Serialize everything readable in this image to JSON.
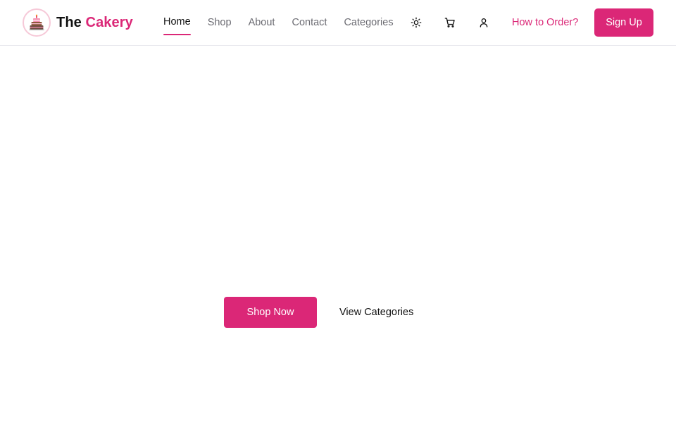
{
  "header": {
    "logo_icon": "layered-cake-icon",
    "brand_first": "The",
    "brand_second": "Cakery",
    "nav": [
      {
        "label": "Home",
        "active": true
      },
      {
        "label": "Shop",
        "active": false
      },
      {
        "label": "About",
        "active": false
      },
      {
        "label": "Contact",
        "active": false
      },
      {
        "label": "Categories",
        "active": false
      }
    ],
    "icons": [
      "sun-icon",
      "cart-icon",
      "user-icon"
    ],
    "how_to_order": "How to Order?",
    "sign_up": "Sign Up"
  },
  "hero": {
    "shop_now": "Shop Now",
    "view_categories": "View Categories"
  },
  "colors": {
    "accent": "#db2777",
    "text": "#111111",
    "muted": "#6b6b72",
    "border": "#e9e9ee"
  }
}
